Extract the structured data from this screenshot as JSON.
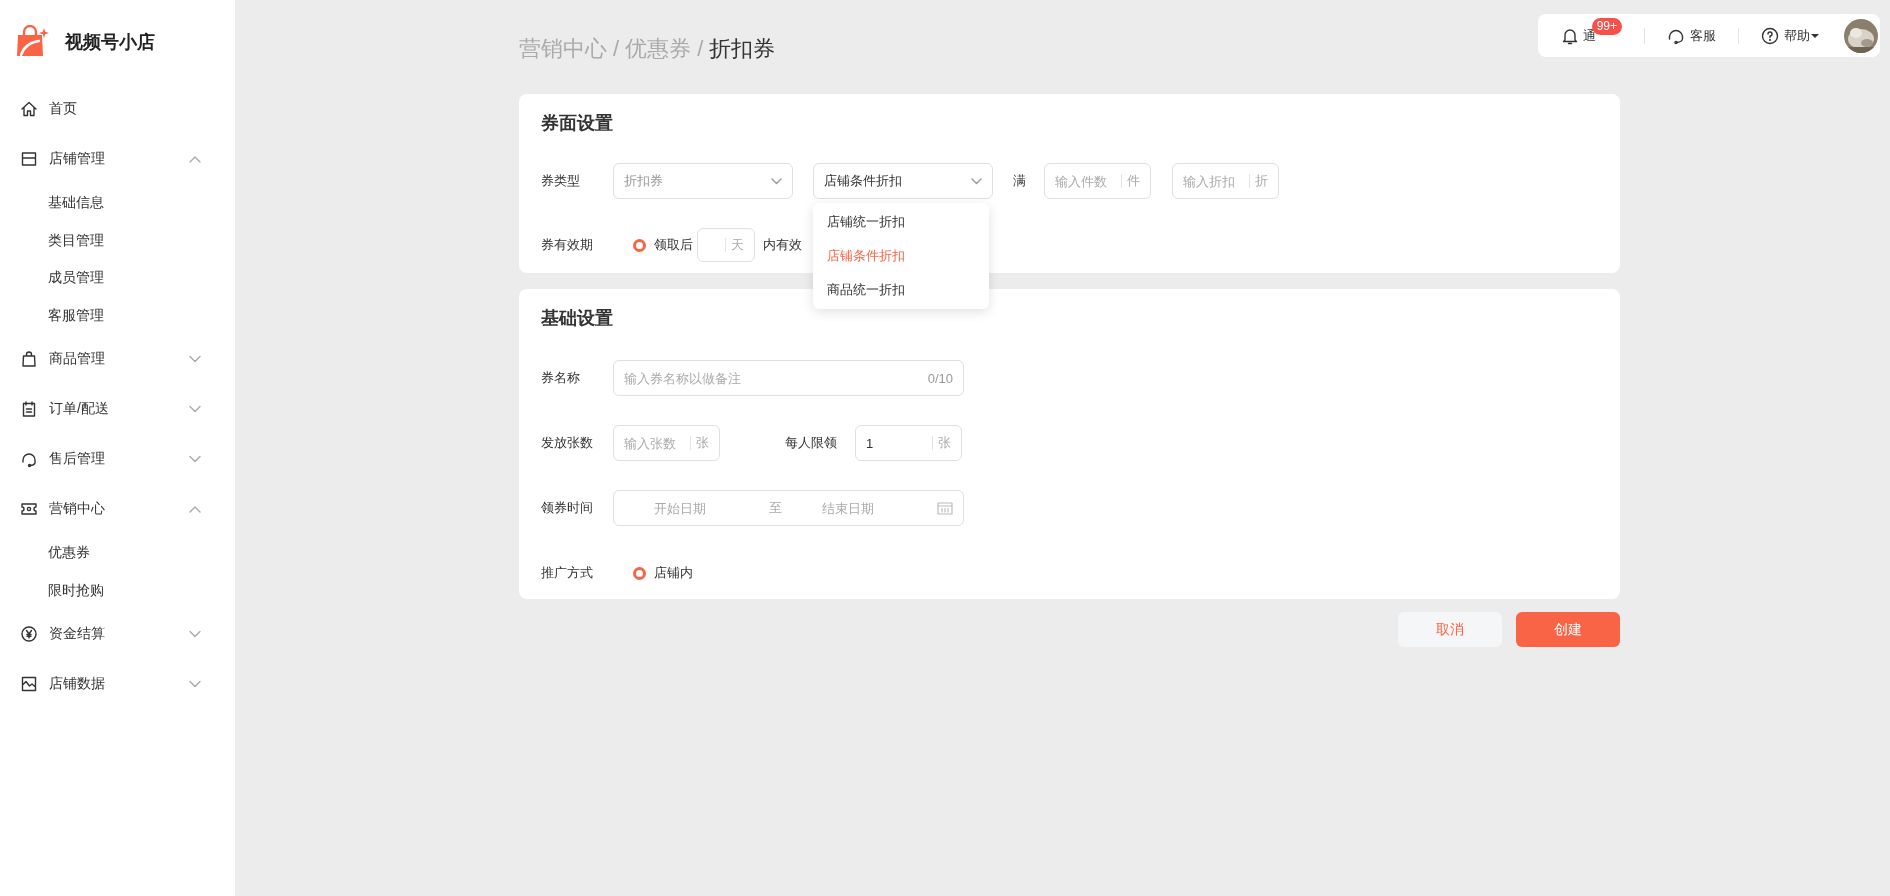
{
  "sidebar": {
    "logo_text": "视频号小店",
    "items": [
      {
        "label": "首页"
      },
      {
        "label": "店铺管理",
        "expanded": true,
        "children": [
          {
            "label": "基础信息"
          },
          {
            "label": "类目管理"
          },
          {
            "label": "成员管理"
          },
          {
            "label": "客服管理"
          }
        ]
      },
      {
        "label": "商品管理",
        "expanded": false
      },
      {
        "label": "订单/配送",
        "expanded": false
      },
      {
        "label": "售后管理",
        "expanded": false
      },
      {
        "label": "营销中心",
        "expanded": true,
        "children": [
          {
            "label": "优惠券"
          },
          {
            "label": "限时抢购"
          }
        ]
      },
      {
        "label": "资金结算",
        "expanded": false
      },
      {
        "label": "店铺数据",
        "expanded": false
      }
    ]
  },
  "header": {
    "notifications": {
      "label": "通",
      "badge": "99+"
    },
    "service": {
      "label": "客服"
    },
    "help": {
      "label": "帮助"
    }
  },
  "breadcrumb": {
    "separator": "/",
    "items": [
      "营销中心",
      "优惠券",
      "折扣券"
    ]
  },
  "coupon_face": {
    "title": "券面设置",
    "type_label": "券类型",
    "type_select": {
      "placeholder": "折扣券"
    },
    "mode_select": {
      "value": "店铺条件折扣",
      "open": true,
      "options": [
        {
          "label": "店铺统一折扣",
          "selected": false
        },
        {
          "label": "店铺条件折扣",
          "selected": true
        },
        {
          "label": "商品统一折扣",
          "selected": false
        }
      ]
    },
    "threshold_label": "满",
    "qty_input": {
      "placeholder": "输入件数",
      "unit": "件"
    },
    "discount_input": {
      "placeholder": "输入折扣",
      "unit": "折"
    },
    "validity_label": "券有效期",
    "validity": {
      "radio_label": "领取后",
      "selected": true,
      "unit": "天",
      "suffix": "内有效"
    }
  },
  "basic": {
    "title": "基础设置",
    "name_field": {
      "label": "券名称",
      "placeholder": "输入券名称以做备注",
      "counter": "0/10"
    },
    "quantity": {
      "label": "发放张数",
      "placeholder": "输入张数",
      "unit": "张"
    },
    "limit": {
      "label": "每人限领",
      "value": "1",
      "unit": "张"
    },
    "period": {
      "label": "领券时间",
      "start_placeholder": "开始日期",
      "separator": "至",
      "end_placeholder": "结束日期"
    },
    "promotion": {
      "label": "推广方式",
      "options": [
        {
          "label": "店铺内",
          "selected": true
        }
      ]
    }
  },
  "actions": {
    "cancel": "取消",
    "create": "创建"
  }
}
